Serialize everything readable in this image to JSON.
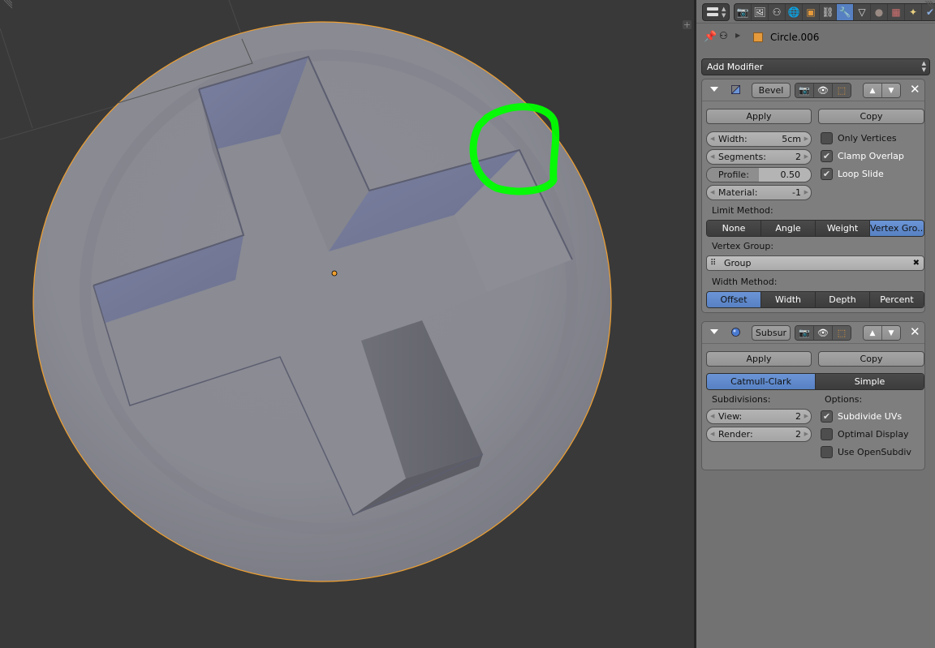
{
  "viewport": {
    "object_name": "Circle.006",
    "annotation_color": "#00ff00",
    "selection_outline_color": "#f0a030",
    "origin_color": "#f0a030",
    "add_button_label": "+"
  },
  "properties": {
    "header": {
      "tabs": [
        {
          "name": "render",
          "icon": "📷"
        },
        {
          "name": "render-layers",
          "icon": "🖼"
        },
        {
          "name": "scene",
          "icon": "⚇"
        },
        {
          "name": "world",
          "icon": "🌐"
        },
        {
          "name": "object",
          "icon": "▣"
        },
        {
          "name": "constraints",
          "icon": "⛓"
        },
        {
          "name": "modifiers",
          "icon": "🔧",
          "active": true
        },
        {
          "name": "data",
          "icon": "▽"
        },
        {
          "name": "material",
          "icon": "●"
        },
        {
          "name": "texture",
          "icon": "▦"
        },
        {
          "name": "particles",
          "icon": "✦"
        },
        {
          "name": "physics",
          "icon": "✔"
        }
      ]
    },
    "context": {
      "pin_icon": "📌",
      "object_name": "Circle.006"
    },
    "add_modifier_label": "Add Modifier",
    "bevel": {
      "name": "Bevel",
      "apply_label": "Apply",
      "copy_label": "Copy",
      "width_label": "Width:",
      "width_value": "5cm",
      "segments_label": "Segments:",
      "segments_value": "2",
      "profile_label": "Profile:",
      "profile_value": "0.50",
      "profile_fraction": 0.5,
      "material_label": "Material:",
      "material_value": "-1",
      "only_vertices_label": "Only Vertices",
      "only_vertices_checked": false,
      "clamp_overlap_label": "Clamp Overlap",
      "clamp_overlap_checked": true,
      "loop_slide_label": "Loop Slide",
      "loop_slide_checked": true,
      "limit_method_label": "Limit Method:",
      "limit_methods": [
        "None",
        "Angle",
        "Weight",
        "Vertex Gro..."
      ],
      "limit_method_active": "Vertex Gro...",
      "vertex_group_label": "Vertex Group:",
      "vertex_group_value": "Group",
      "width_method_label": "Width Method:",
      "width_methods": [
        "Offset",
        "Width",
        "Depth",
        "Percent"
      ],
      "width_method_active": "Offset"
    },
    "subsurf": {
      "name": "Subsur",
      "apply_label": "Apply",
      "copy_label": "Copy",
      "types": [
        "Catmull-Clark",
        "Simple"
      ],
      "type_active": "Catmull-Clark",
      "subdivisions_label": "Subdivisions:",
      "view_label": "View:",
      "view_value": "2",
      "render_label": "Render:",
      "render_value": "2",
      "options_label": "Options:",
      "subdivide_uvs_label": "Subdivide UVs",
      "subdivide_uvs_checked": true,
      "optimal_display_label": "Optimal Display",
      "optimal_display_checked": false,
      "use_opensubdiv_label": "Use OpenSubdiv",
      "use_opensubdiv_checked": false
    },
    "icons": {
      "check": "✔",
      "close": "✕",
      "up": "▲",
      "down": "▼",
      "camera": "📷",
      "eye": "👁",
      "editmode": "⬚",
      "vgroup": "⠿",
      "clear": "✖",
      "arrow_left": "◀",
      "arrow_right": "▶"
    }
  }
}
